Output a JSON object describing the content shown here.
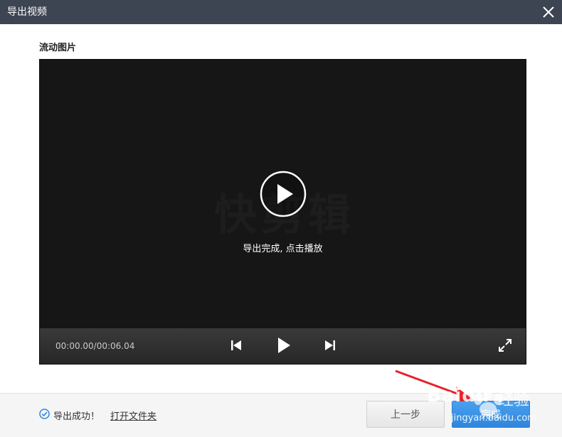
{
  "window": {
    "title": "导出视频"
  },
  "section": {
    "label": "流动图片"
  },
  "player": {
    "watermark": "快剪辑",
    "message": "导出完成, 点击播放",
    "time": "00:00.00/00:06.04"
  },
  "footer": {
    "status": "导出成功！",
    "open_folder": "打开文件夹",
    "prev_button": "上一步",
    "done_button": "完成"
  },
  "watermark": {
    "brand": "Baidu",
    "cn": "经验",
    "url": "jingyan.baidu.com"
  },
  "icons": {
    "close": "close-icon",
    "play_big": "play-circle-icon",
    "prev": "skip-previous-icon",
    "play": "play-icon",
    "next": "skip-next-icon",
    "fullscreen": "fullscreen-icon",
    "success": "check-circle-icon"
  },
  "colors": {
    "titlebar": "#3d4452",
    "accent": "#2f86dc",
    "annotation": "#e8202a"
  }
}
